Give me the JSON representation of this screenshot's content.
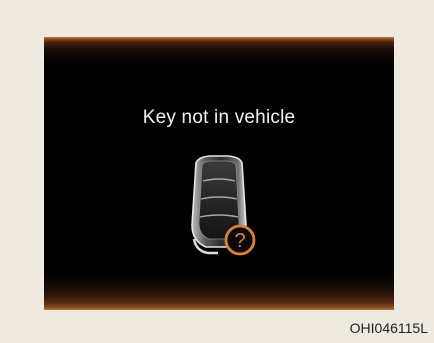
{
  "display": {
    "message": "Key not in vehicle",
    "icon": "smart-key-question-icon",
    "icon_glyph": "?",
    "accent_color": "#d9823a",
    "frame_glow_color": "#c27a3c"
  },
  "caption": {
    "figure_code": "OHI046115L"
  }
}
